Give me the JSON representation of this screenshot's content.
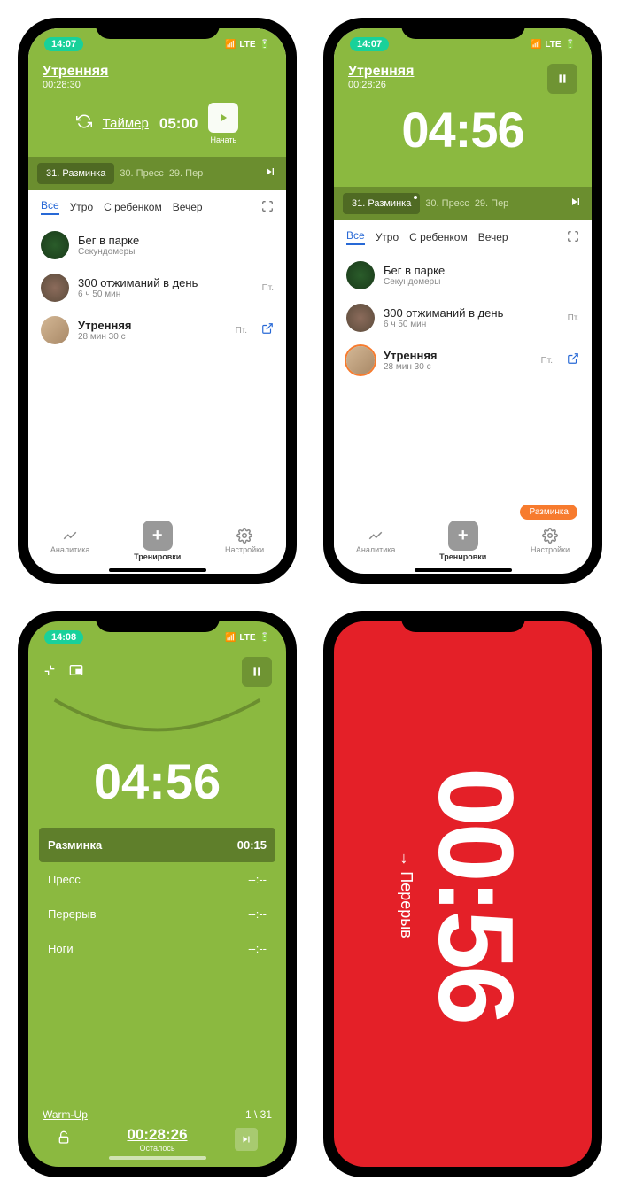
{
  "status": {
    "time1": "14:07",
    "time3": "14:08",
    "network": "LTE"
  },
  "header": {
    "title": "Утренняя",
    "duration1": "00:28:30",
    "duration2": "00:28:26",
    "timer_label": "Таймер",
    "timer_value": "05:00",
    "start_label": "Начать",
    "big_timer": "04:56"
  },
  "tabs": {
    "active": "31. Разминка",
    "t2": "30. Пресс",
    "t3": "29. Пер"
  },
  "filters": {
    "f1": "Все",
    "f2": "Утро",
    "f3": "С ребенком",
    "f4": "Вечер"
  },
  "list": [
    {
      "title": "Бег в парке",
      "sub": "Секундомеры",
      "meta": ""
    },
    {
      "title": "300 отжиманий в день",
      "sub": "6 ч 50 мин",
      "meta": "Пт."
    },
    {
      "title": "Утренняя",
      "sub": "28 мин 30 с",
      "meta": "Пт."
    }
  ],
  "nav": {
    "n1": "Аналитика",
    "n2": "Тренировки",
    "n3": "Настройки"
  },
  "badge": "Разминка",
  "s3": {
    "timer": "04:56",
    "ex": [
      {
        "name": "Разминка",
        "time": "00:15"
      },
      {
        "name": "Пресс",
        "time": "--:--"
      },
      {
        "name": "Перерыв",
        "time": "--:--"
      },
      {
        "name": "Ноги",
        "time": "--:--"
      }
    ],
    "warmup": "Warm-Up",
    "progress": "1 \\ 31",
    "remain_time": "00:28:26",
    "remain_label": "Осталось"
  },
  "s4": {
    "time": "00:56",
    "next": "→ Перерыв"
  }
}
